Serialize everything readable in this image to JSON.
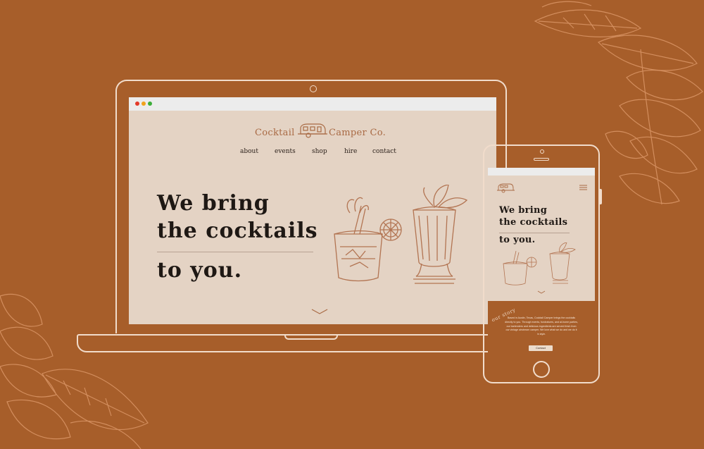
{
  "colors": {
    "background": "#a75e2a",
    "page": "#e4d3c4",
    "accent": "#a96a44",
    "ink": "#1e1814",
    "device_outline": "#f1dccb"
  },
  "site": {
    "logo_left": "Cocktail",
    "logo_right": "Camper Co.",
    "logo_icon": "camper-trailer-icon",
    "nav": [
      "about",
      "events",
      "shop",
      "hire",
      "contact"
    ],
    "hero": {
      "line1": "We bring",
      "line2": "the cocktails",
      "line3": "to you."
    },
    "scroll_icon": "chevron-down-icon"
  },
  "mobile": {
    "menu_icon": "hamburger-menu-icon",
    "hero": {
      "line1": "We bring",
      "line2": "the cocktails",
      "line3": "to you."
    },
    "story_label": "our story",
    "story_text": "Based in Austin, Texas, Cocktail Camper brings the cocktails directly to you. Through events, fundraisers, and at-home parties, our bartenders and delicious ingredients are served fresh from our vintage airstream camper. We love what we do and we do it in style.",
    "contact_button": "Contact"
  }
}
